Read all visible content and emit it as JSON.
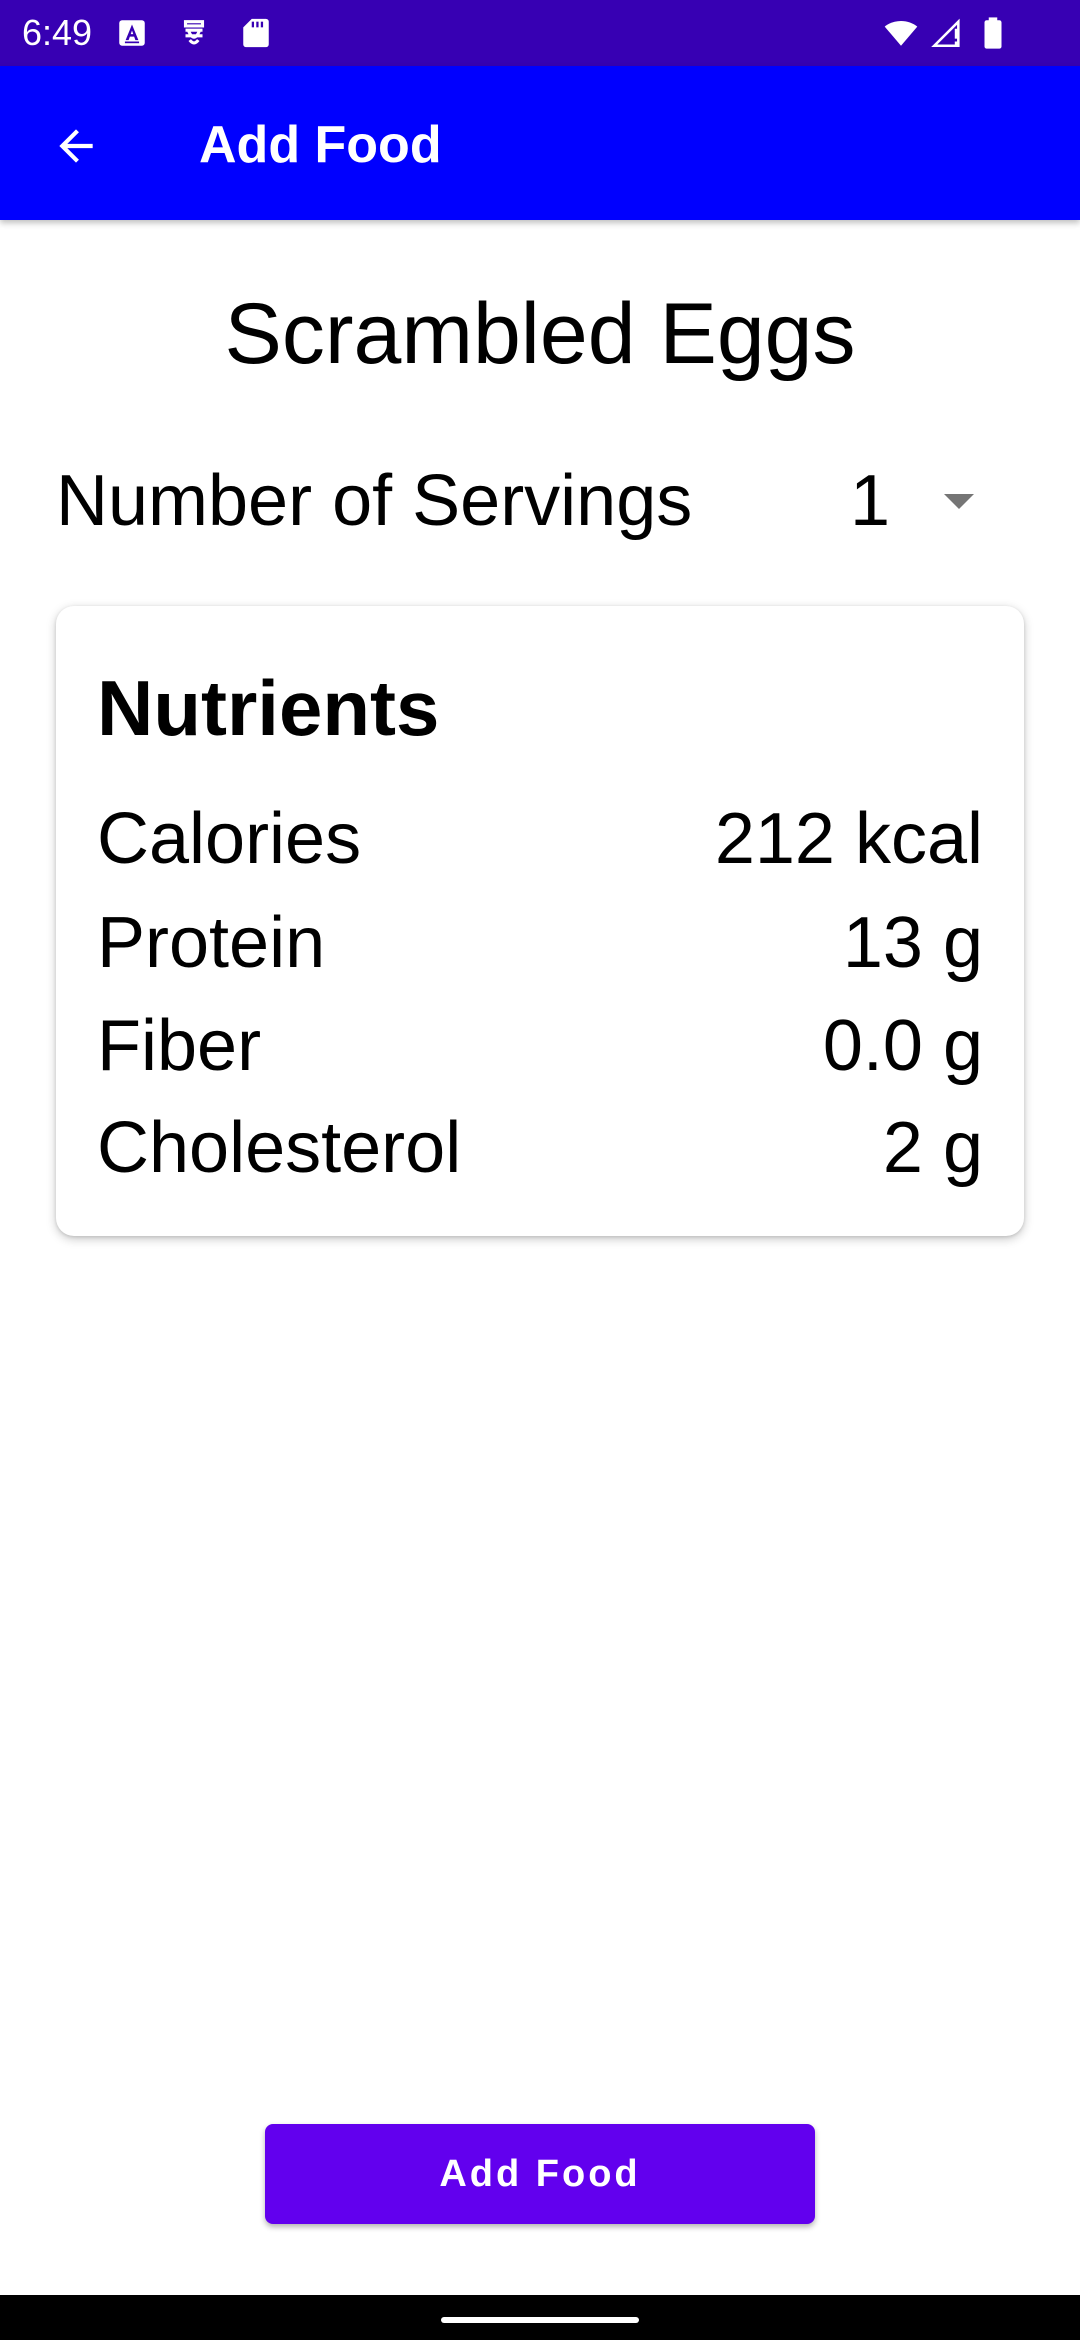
{
  "status_bar": {
    "time": "6:49",
    "icons": [
      "a-notification-icon",
      "settings-notification-icon",
      "sd-card-icon",
      "wifi-icon",
      "signal-icon",
      "battery-icon"
    ],
    "color": "#3700b3"
  },
  "app_bar": {
    "title": "Add Food",
    "back_icon": "arrow-back-icon",
    "color": "#0000ff"
  },
  "food": {
    "name": "Scrambled Eggs"
  },
  "servings": {
    "label": "Number of Servings",
    "value": "1"
  },
  "nutrients": {
    "title": "Nutrients",
    "items": [
      {
        "name": "Calories",
        "value": "212 kcal"
      },
      {
        "name": "Protein",
        "value": "13 g"
      },
      {
        "name": "Fiber",
        "value": "0.0 g"
      },
      {
        "name": "Cholesterol",
        "value": "2 g"
      }
    ]
  },
  "actions": {
    "add_label": "Add Food",
    "button_color": "#6200ee"
  }
}
